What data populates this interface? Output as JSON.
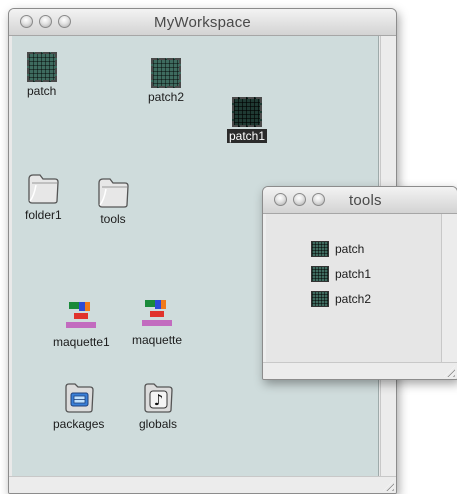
{
  "main_window": {
    "title": "MyWorkspace",
    "items": [
      {
        "label": "patch",
        "icon": "patch-icon",
        "selected": false
      },
      {
        "label": "patch2",
        "icon": "patch-icon",
        "selected": false
      },
      {
        "label": "patch1",
        "icon": "patch-icon",
        "selected": true
      },
      {
        "label": "folder1",
        "icon": "folder-icon",
        "selected": false
      },
      {
        "label": "tools",
        "icon": "folder-icon",
        "selected": false
      },
      {
        "label": "maquette1",
        "icon": "maquette-icon",
        "selected": false
      },
      {
        "label": "maquette",
        "icon": "maquette-icon",
        "selected": false
      },
      {
        "label": "packages",
        "icon": "packages-icon",
        "selected": false
      },
      {
        "label": "globals",
        "icon": "globals-icon",
        "selected": false
      }
    ]
  },
  "tools_window": {
    "title": "tools",
    "items": [
      {
        "label": "patch",
        "icon": "patch-icon"
      },
      {
        "label": "patch1",
        "icon": "patch-icon"
      },
      {
        "label": "patch2",
        "icon": "patch-icon"
      }
    ]
  },
  "colors": {
    "workspace_bg": "#cfdcdc",
    "selection_bg": "#2b2b2b"
  }
}
